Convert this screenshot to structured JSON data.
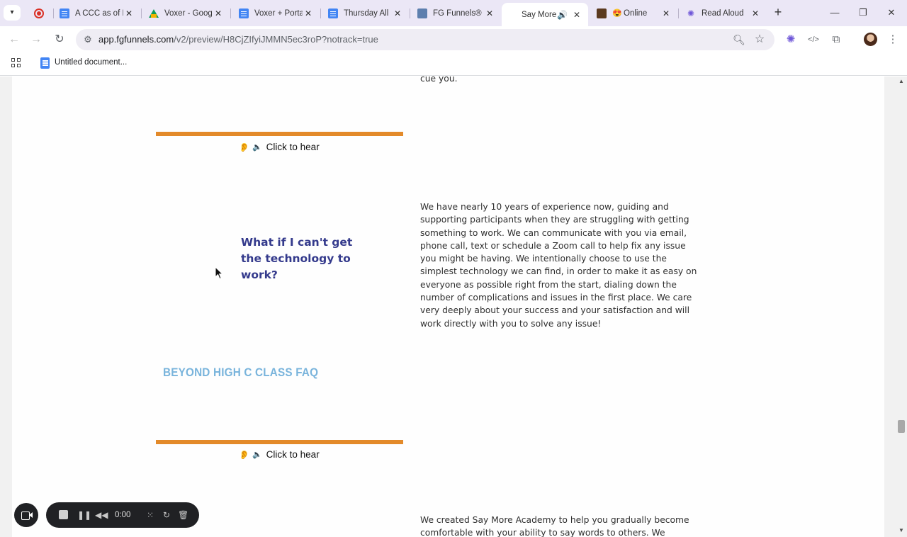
{
  "browser": {
    "tabs": [
      {
        "title": "",
        "icon": "record-icon"
      },
      {
        "title": "A CCC as of F",
        "icon": "docs-icon"
      },
      {
        "title": "Voxer - Goog",
        "icon": "drive-icon"
      },
      {
        "title": "Voxer + Porta",
        "icon": "docs-icon"
      },
      {
        "title": "Thursday All",
        "icon": "docs-icon"
      },
      {
        "title": "FG Funnels®",
        "icon": "fgfunnels-icon"
      },
      {
        "title": "Say More",
        "icon": "speaker-icon",
        "active": true
      },
      {
        "title": "Online",
        "icon": "game-icon"
      },
      {
        "title": "Read Aloud",
        "icon": "read-aloud-icon"
      }
    ],
    "url_host": "app.fgfunnels.com",
    "url_path": "/v2/preview/H8CjZIfyiJMMN5ec3roP?notrack=true",
    "bookmark_label": "Untitled document..."
  },
  "page": {
    "partial_text": "cue you.",
    "click_to_hear_1": "Click to hear",
    "faq_question": "What if I can't get the technology to work?",
    "faq_answer": "We have nearly 10 years of experience now, guiding and supporting participants when they are struggling with getting something to work. We can communicate with you via email, phone call, text or schedule a Zoom call to help fix any issue you might be having. We intentionally choose to use the simplest technology we can find, in order to make it as easy on everyone as possible right from the start, dialing down the number of complications and issues in the first place. We care very deeply about your success and your satisfaction and will work directly with you to solve any issue!",
    "section_heading": "BEYOND HIGH C CLASS FAQ",
    "click_to_hear_2": "Click to hear",
    "next_answer": "We created Say More Academy to help you gradually become comfortable with your ability to say words to others. We encourage"
  },
  "recorder": {
    "time": "0:00"
  },
  "colors": {
    "accent_orange": "#e38a2a",
    "question_navy": "#343a8c",
    "heading_blue": "#79b4dc"
  }
}
